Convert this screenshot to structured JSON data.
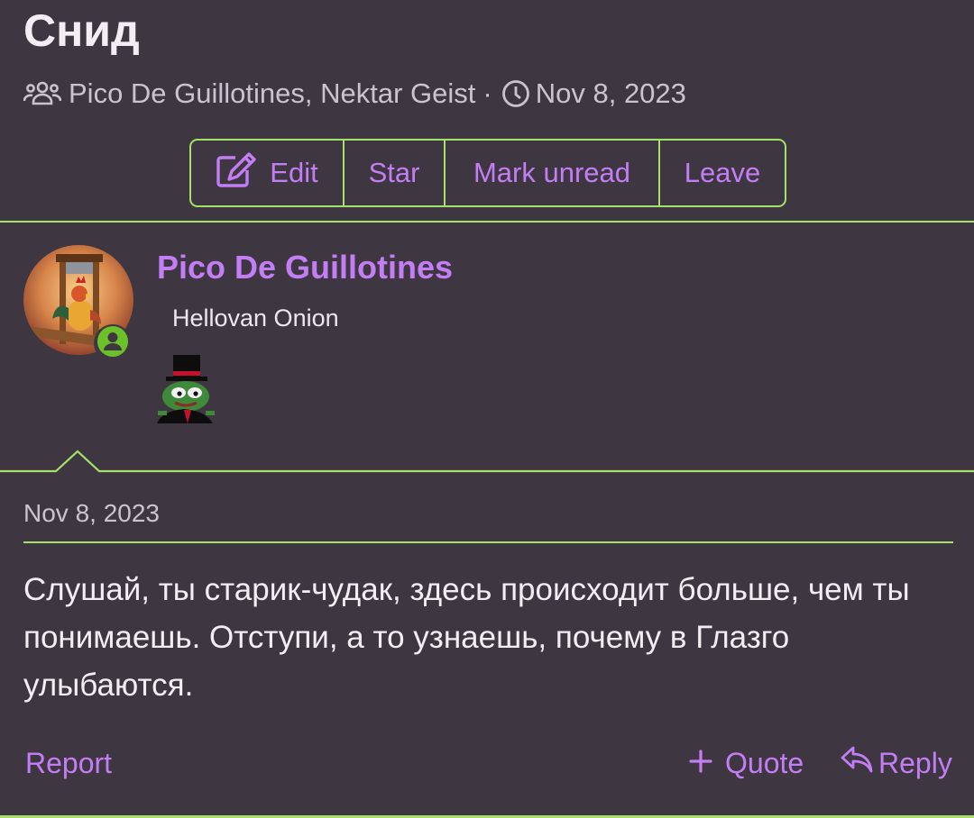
{
  "thread": {
    "title": "Снид",
    "participants": "Pico De Guillotines, Nektar Geist",
    "separator": "·",
    "date": "Nov 8, 2023",
    "icons": {
      "participants": "users-icon",
      "date": "clock-icon"
    }
  },
  "actions": {
    "edit": "Edit",
    "star": "Star",
    "mark_unread": "Mark unread",
    "leave": "Leave"
  },
  "post": {
    "author": "Pico De Guillotines",
    "user_title": "Hellovan Onion",
    "date": "Nov 8, 2023",
    "body": "Слушай, ты старик-чудак, здесь происходит больше, чем ты понимаешь. Отступи, а то узнаешь, почему в Глазго улыбаются.",
    "report": "Report",
    "quote": "Quote",
    "reply": "Reply"
  },
  "colors": {
    "background": "#3e3640",
    "accent": "#c47ef5",
    "border": "#a6e06a",
    "online": "#6cc02a"
  }
}
